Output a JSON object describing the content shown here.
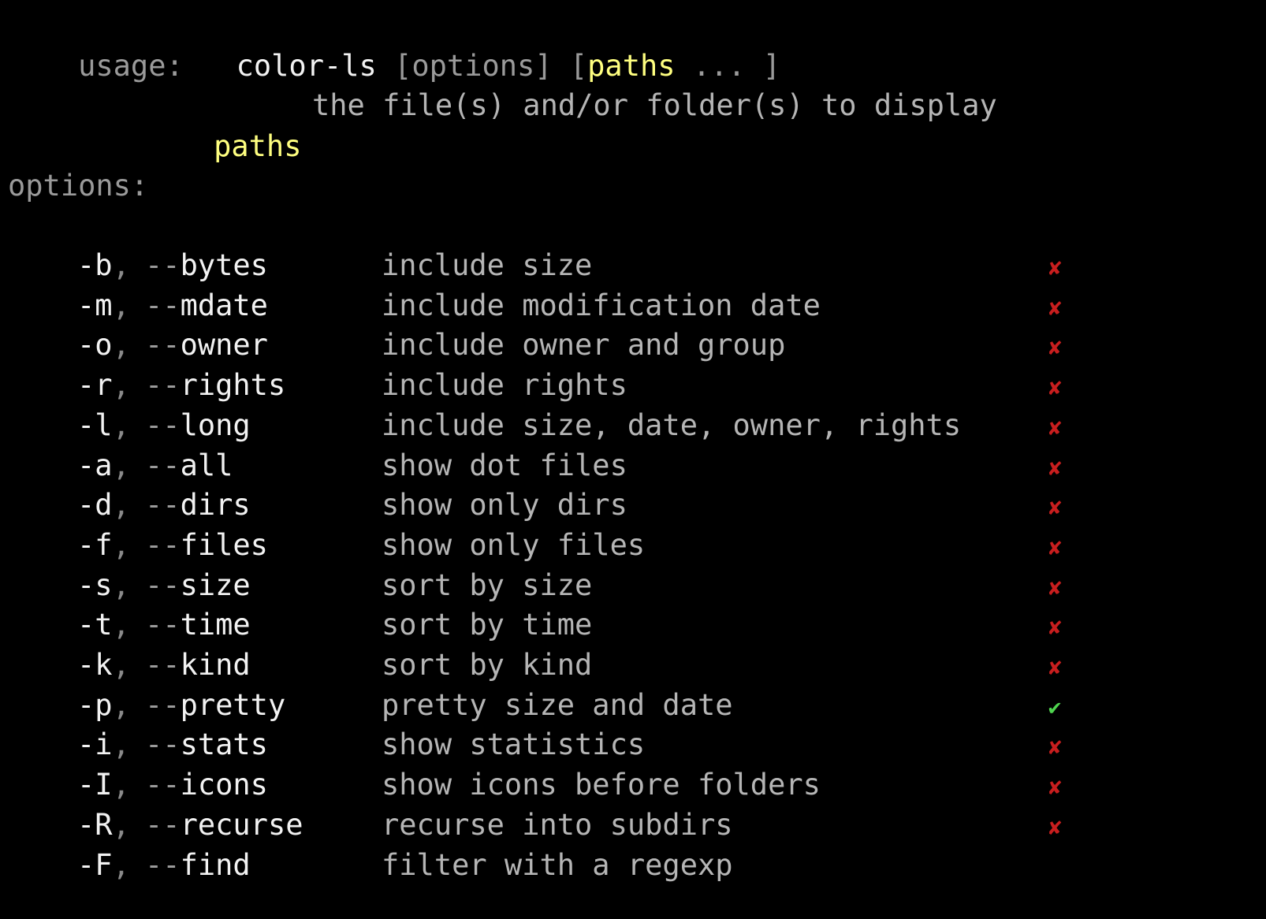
{
  "usage": {
    "label": "usage:",
    "command": "color-ls",
    "open_options": "[options]",
    "open_bracket": "[",
    "paths_word": "paths",
    "ellipsis": "...",
    "close_bracket": "]"
  },
  "paths": {
    "name": "paths",
    "description": "the file(s) and/or folder(s) to display"
  },
  "options_header": "options:",
  "options": [
    {
      "short": "-b",
      "long_flag": "bytes",
      "description": "include size",
      "enabled": false
    },
    {
      "short": "-m",
      "long_flag": "mdate",
      "description": "include modification date",
      "enabled": false
    },
    {
      "short": "-o",
      "long_flag": "owner",
      "description": "include owner and group",
      "enabled": false
    },
    {
      "short": "-r",
      "long_flag": "rights",
      "description": "include rights",
      "enabled": false
    },
    {
      "short": "-l",
      "long_flag": "long",
      "description": "include size, date, owner, rights",
      "enabled": false
    },
    {
      "short": "-a",
      "long_flag": "all",
      "description": "show dot files",
      "enabled": false
    },
    {
      "short": "-d",
      "long_flag": "dirs",
      "description": "show only dirs",
      "enabled": false
    },
    {
      "short": "-f",
      "long_flag": "files",
      "description": "show only files",
      "enabled": false
    },
    {
      "short": "-s",
      "long_flag": "size",
      "description": "sort by size",
      "enabled": false
    },
    {
      "short": "-t",
      "long_flag": "time",
      "description": "sort by time",
      "enabled": false
    },
    {
      "short": "-k",
      "long_flag": "kind",
      "description": "sort by kind",
      "enabled": false
    },
    {
      "short": "-p",
      "long_flag": "pretty",
      "description": "pretty size and date",
      "enabled": true
    },
    {
      "short": "-i",
      "long_flag": "stats",
      "description": "show statistics",
      "enabled": false
    },
    {
      "short": "-I",
      "long_flag": "icons",
      "description": "show icons before folders",
      "enabled": false
    },
    {
      "short": "-R",
      "long_flag": "recurse",
      "description": "recurse into subdirs",
      "enabled": false
    },
    {
      "short": "-F",
      "long_flag": "find",
      "description": "filter with a regexp",
      "enabled": null
    }
  ],
  "marks": {
    "enabled_glyph": "✔",
    "disabled_glyph": "✘"
  },
  "colors": {
    "background": "#000000",
    "highlight": "#ffff80",
    "enabled": "#4fd44f",
    "disabled": "#c81e1e"
  }
}
